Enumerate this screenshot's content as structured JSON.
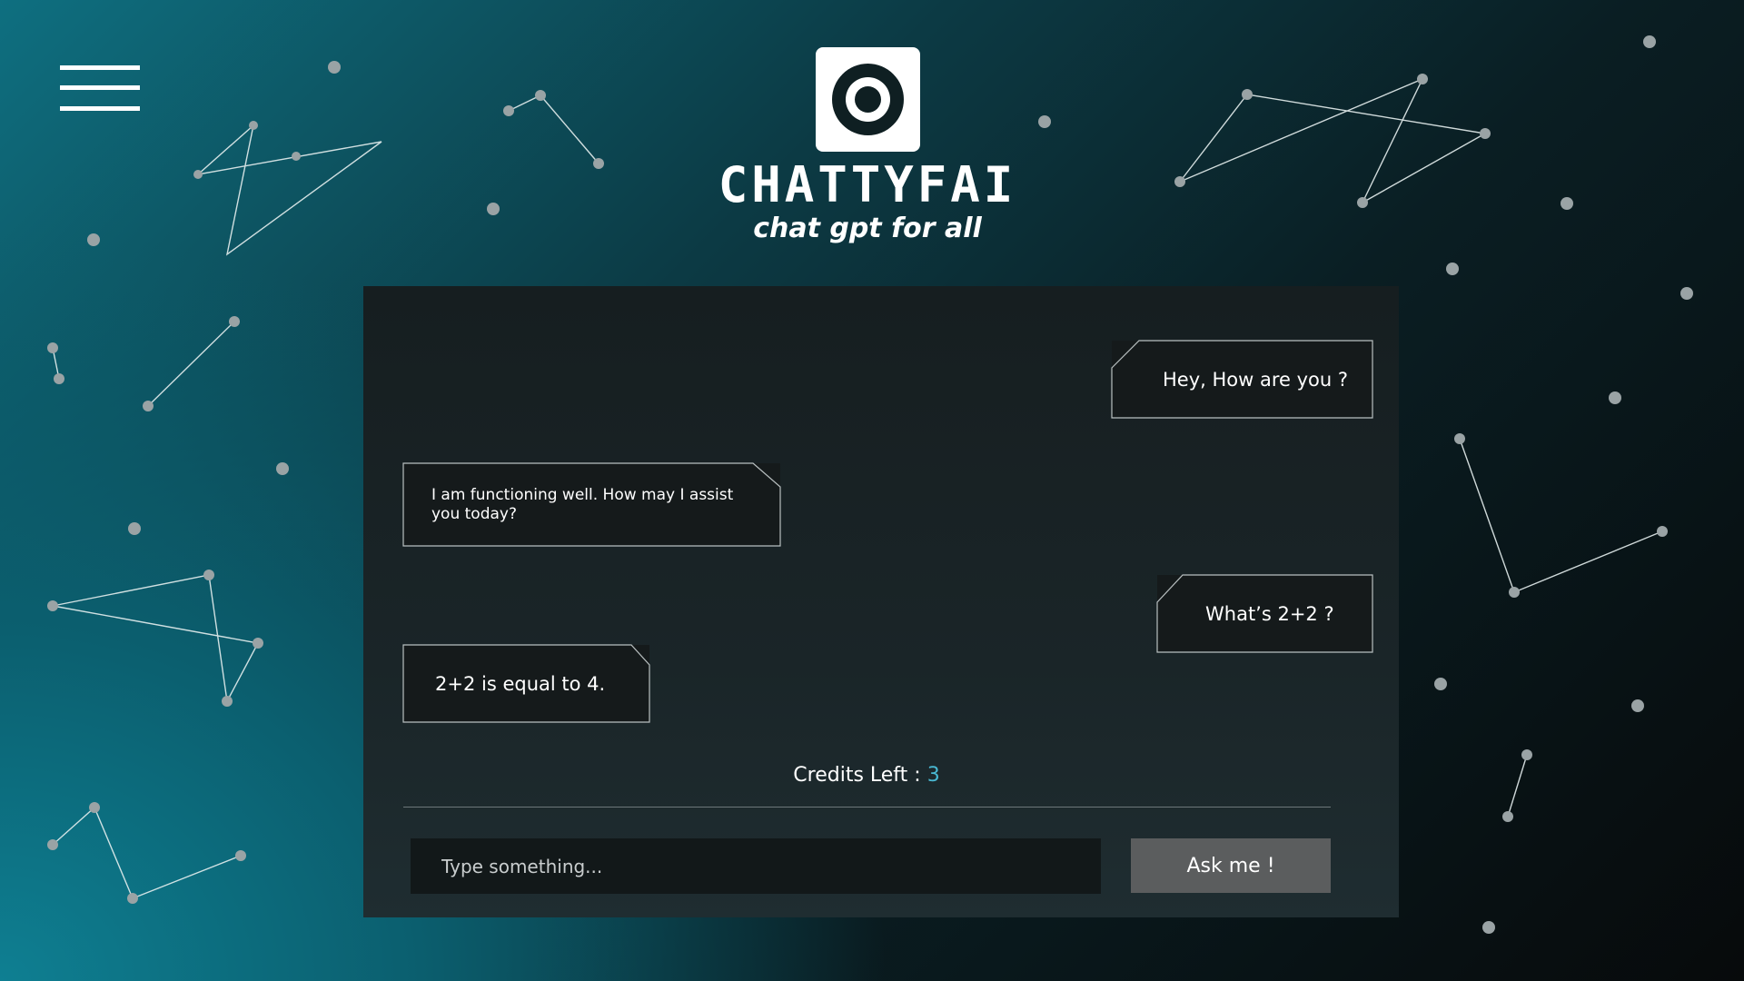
{
  "header": {
    "menu_icon": "hamburger-menu-icon",
    "logo_icon": "target-ring-icon",
    "brand_name": "CHATTYFAI",
    "tagline": "chat gpt for all"
  },
  "chat": {
    "messages": [
      {
        "role": "user",
        "text": "Hey, How are you ?"
      },
      {
        "role": "assistant",
        "text": "I am functioning well. How may I assist you today?"
      },
      {
        "role": "user",
        "text": "What’s 2+2 ?"
      },
      {
        "role": "assistant",
        "text": "2+2 is equal to 4."
      }
    ],
    "credits_label": "Credits Left :",
    "credits_value": "3"
  },
  "composer": {
    "placeholder": "Type something...",
    "value": "",
    "submit_label": "Ask me !"
  },
  "colors": {
    "accent": "#49b8d2",
    "panel": "#1a2528",
    "bubble": "#151a1b",
    "button": "#5b5d5e"
  }
}
